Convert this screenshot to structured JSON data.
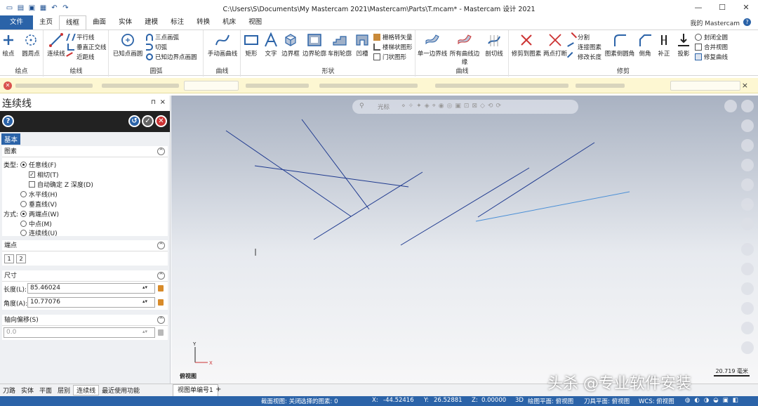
{
  "titlebar": {
    "title": "C:\\Users\\S\\Documents\\My Mastercam 2021\\Mastercam\\Parts\\T.mcam* - Mastercam 设计 2021"
  },
  "tabs": [
    "文件",
    "主页",
    "线框",
    "曲面",
    "实体",
    "建模",
    "标注",
    "转换",
    "机床",
    "视图"
  ],
  "my_mastercam": "我的 Mastercam",
  "ribbon": {
    "points": {
      "label": "绘点",
      "b1": "绘点",
      "b2": "圆周点"
    },
    "lines": {
      "label": "绘线",
      "big": "连续线",
      "s1": "平行线",
      "s2": "垂直正交线",
      "s3": "近距线"
    },
    "arcs": {
      "label": "圆弧",
      "big": "已知点画圆",
      "s1": "三点画弧",
      "s2": "切弧",
      "s3": "已知边界点画圆"
    },
    "spline": {
      "label": "曲线",
      "big": "手动画曲线"
    },
    "shapes": {
      "label": "形状",
      "b1": "矩形",
      "b2": "文字",
      "b3": "边界框",
      "b4": "边界轮廓",
      "b5": "车削轮廓",
      "b6": "凹槽",
      "s1": "栅格转矢量",
      "s2": "楼梯状图形",
      "s3": "门状图形"
    },
    "curves": {
      "label": "曲线",
      "b1": "单一边界线",
      "b2": "所有曲线边缘",
      "b3": "剖切线"
    },
    "modify": {
      "label": "修剪",
      "b1": "修剪到图素",
      "b2": "两点打断",
      "s1": "分割",
      "s2": "连接图素",
      "s3": "修改长度",
      "b3": "图素倒圆角",
      "b4": "倒角",
      "b5": "补正",
      "b6": "投影",
      "s4": "封闭全圆",
      "s5": "合并视图",
      "s6": "修复曲线"
    }
  },
  "panel": {
    "title": "连续线",
    "basic_tab": "基本",
    "entity_section": "图素",
    "type_label": "类型:",
    "type_opts": [
      "任意线(F)",
      "相切(T)",
      "自动确定 Z 深度(D)",
      "水平线(H)",
      "垂直线(V)"
    ],
    "method_label": "方式:",
    "method_opts": [
      "两端点(W)",
      "中点(M)",
      "连续线(U)"
    ],
    "endpoints_section": "端点",
    "ep1": "1",
    "ep2": "2",
    "dimension_section": "尺寸",
    "length_label": "长度(L):",
    "length_value": "85.46024",
    "angle_label": "角度(A):",
    "angle_value": "10.77076",
    "axial_section": "轴向偏移(S)",
    "axial_value": "0.0"
  },
  "viewport": {
    "toolbar_label": "光标",
    "view_label": "俯视图",
    "scale": "20.719 毫米",
    "axis_x": "X",
    "axis_y": "Y"
  },
  "bottom_tabs": [
    "刀路",
    "实体",
    "平面",
    "层别",
    "连续线",
    "最近使用功能"
  ],
  "view_tab": "视图单编号1",
  "status": {
    "section_view": "截面视图: 关闭",
    "selected": "选择的图素: 0",
    "x": "X:",
    "xv": "-44.52416",
    "y": "Y:",
    "yv": "26.52881",
    "z": "Z:",
    "zv": "0.00000",
    "mode": "3D",
    "plane": "绘图平面: 俯视图",
    "tool_plane": "刀具平面: 俯视图",
    "wcs": "WCS: 俯视图"
  },
  "watermark": "头杀 @专业软件安装",
  "colors": {
    "accent": "#2b63a8",
    "line": "#1f3a8f",
    "msgbar": "#fdf7d2"
  }
}
